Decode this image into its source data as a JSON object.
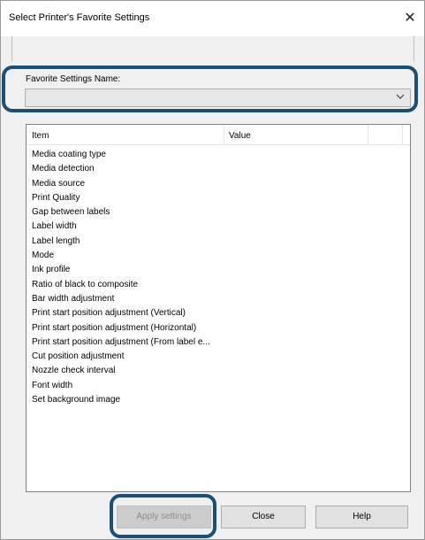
{
  "window": {
    "title": "Select Printer's Favorite Settings",
    "close_glyph": "✕"
  },
  "favorite": {
    "label": "Favorite Settings Name:",
    "value": ""
  },
  "list": {
    "columns": [
      "Item",
      "Value",
      ""
    ],
    "items": [
      "Media coating type",
      "Media detection",
      "Media source",
      "Print Quality",
      "Gap between labels",
      "Label width",
      "Label length",
      "Mode",
      "Ink profile",
      "Ratio of black to composite",
      "Bar width adjustment",
      "Print start position adjustment (Vertical)",
      "Print start position adjustment (Horizontal)",
      "Print start position adjustment (From label e...",
      "Cut position adjustment",
      "Nozzle check interval",
      "Font width",
      "Set background image"
    ]
  },
  "buttons": {
    "apply": "Apply settings",
    "close": "Close",
    "help": "Help"
  },
  "colors": {
    "highlight": "#1a4f7a"
  }
}
